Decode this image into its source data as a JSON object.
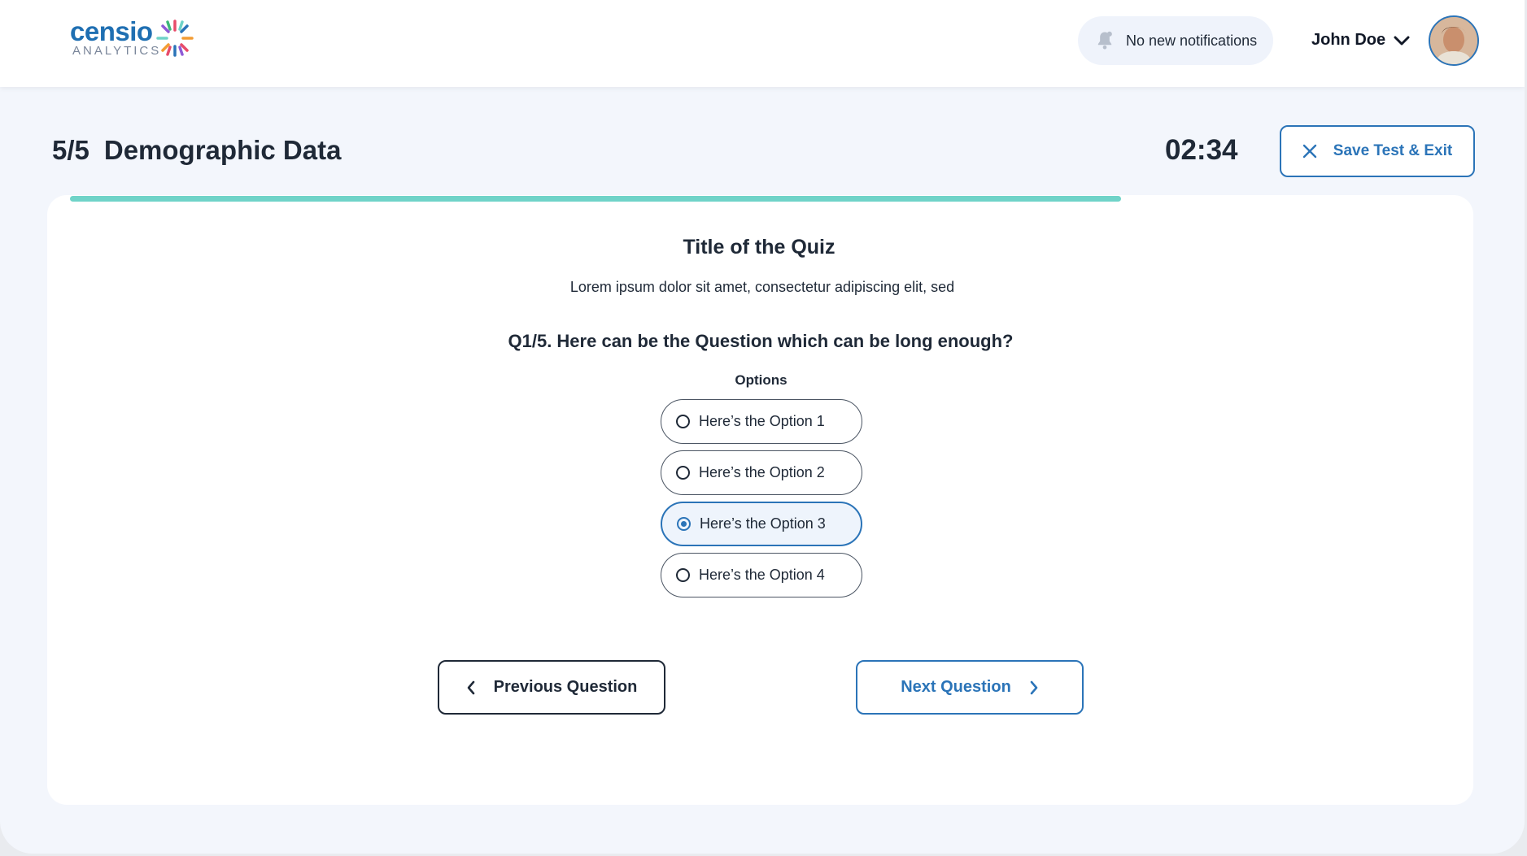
{
  "brand": {
    "name": "censio",
    "subtitle": "ANALYTICS"
  },
  "header": {
    "notifications_text": "No new notifications",
    "user_name": "John Doe"
  },
  "test": {
    "step": "5/5",
    "section_title": "Demographic Data",
    "timer": "02:34",
    "exit_label": "Save Test & Exit",
    "progress": 0.85
  },
  "quiz": {
    "title": "Title of the Quiz",
    "description": "Lorem ipsum dolor sit amet, consectetur adipiscing elit, sed",
    "question": "Q1/5. Here can be the Question which can be long enough?",
    "options_label": "Options",
    "options": [
      {
        "label": "Here’s the Option 1",
        "selected": false
      },
      {
        "label": "Here’s the Option 2",
        "selected": false
      },
      {
        "label": "Here’s the Option 3",
        "selected": true
      },
      {
        "label": "Here’s the Option 4",
        "selected": false
      }
    ]
  },
  "nav": {
    "previous_label": "Previous Question",
    "next_label": "Next Question"
  },
  "colors": {
    "accent": "#2b74b8",
    "progress": "#6fd3c8",
    "background": "#f3f6fc"
  }
}
